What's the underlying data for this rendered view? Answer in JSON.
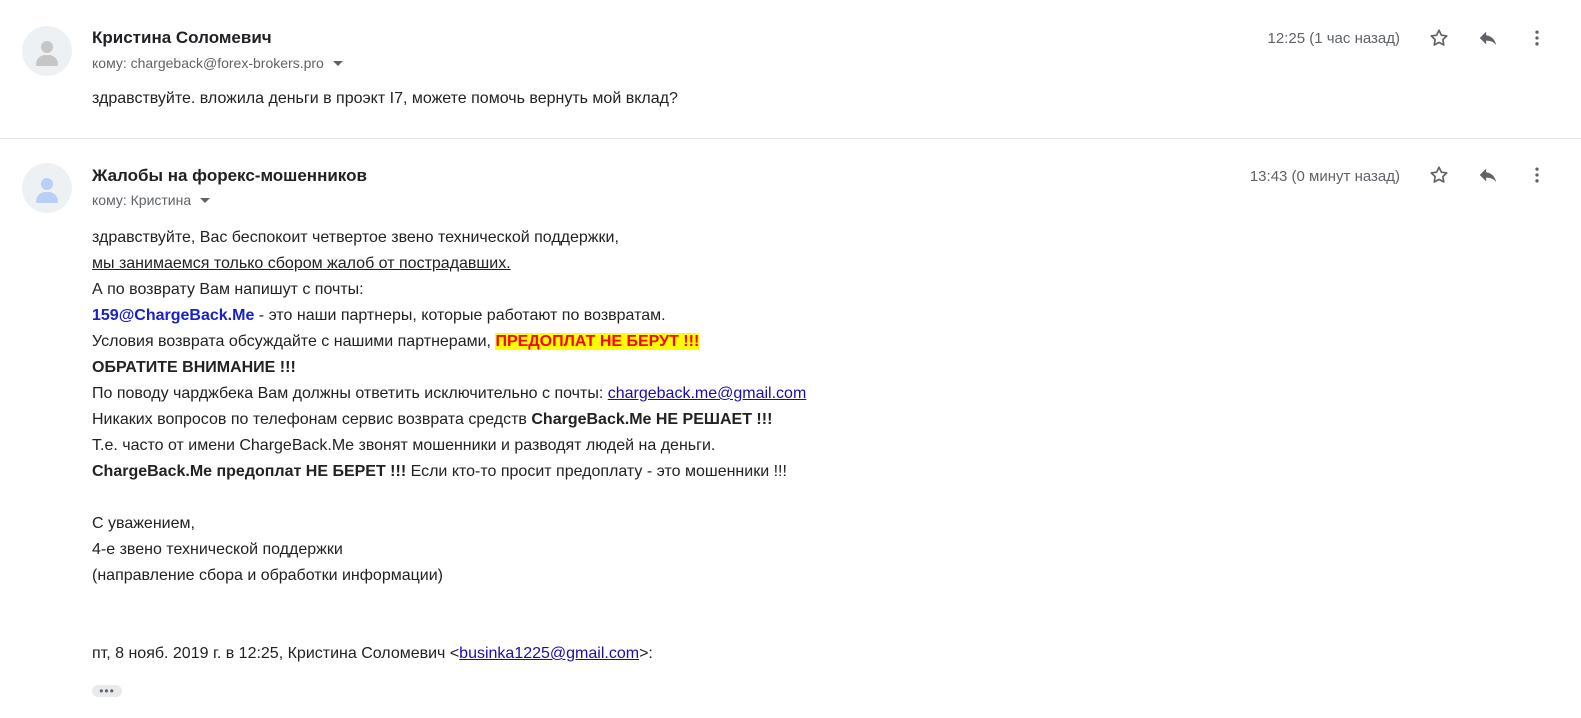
{
  "messages": [
    {
      "sender": "Кристина Соломевич",
      "to_label": "кому: chargeback@forex-brokers.pro",
      "timestamp": "12:25 (1 час назад)",
      "body": "здравствуйте. вложила деньги в проэкт I7, можете помочь вернуть мой вклад?"
    },
    {
      "sender": "Жалобы на форекс-мошенников",
      "to_label": "кому: Кристина",
      "timestamp": "13:43 (0 минут назад)",
      "body": {
        "l1": "здравствуйте, Вас беспокоит четвертое звено технической поддержки,",
        "l2": "мы занимаемся только сбором жалоб от пострадавших.",
        "l3": "А по возврату Вам напишут с почты:",
        "l4_email": "159@ChargeBack.Me",
        "l4_rest": " - это наши партнеры, которые работают по возвратам.",
        "l5_pre": "Условия возврата обсуждайте с нашими партнерами, ",
        "l5_hl": "ПРЕДОПЛАТ НЕ БЕРУТ !!!",
        "l6": "ОБРАТИТЕ ВНИМАНИЕ !!!",
        "l7_pre": "По поводу чарджбека Вам должны ответить исключительно с почты: ",
        "l7_link": "chargeback.me@gmail.com",
        "l8_pre": "Никаких вопросов по телефонам сервис возврата средств ",
        "l8_bold": "ChargeBack.Me НЕ РЕШАЕТ !!!",
        "l9": "Т.е. часто от имени ChargeBack.Me звонят мошенники и разводят людей на деньги.",
        "l10_bold": "ChargeBack.Me предоплат НЕ БЕРЕТ !!!",
        "l10_rest": " Если кто-то просит предоплату - это мошенники !!!",
        "sig1": "С уважением,",
        "sig2": "4-е звено технической поддержки",
        "sig3": "(направление сбора и обработки информации)"
      },
      "quote_pre": "пт, 8 нояб. 2019 г. в 12:25, Кристина Соломевич <",
      "quote_email": "businka1225@gmail.com",
      "quote_post": ">:",
      "ellipsis": "•••"
    }
  ],
  "icons": {
    "avatar": "person-icon",
    "star": "star-icon",
    "reply": "reply-icon",
    "more": "more-vert-icon",
    "caret": "caret-down-icon"
  },
  "colors": {
    "link": "#1a0dab",
    "partner_email": "#1a21c8",
    "highlight_bg": "#ffff00",
    "highlight_text": "#ff0000",
    "meta_text": "#5f6368"
  }
}
